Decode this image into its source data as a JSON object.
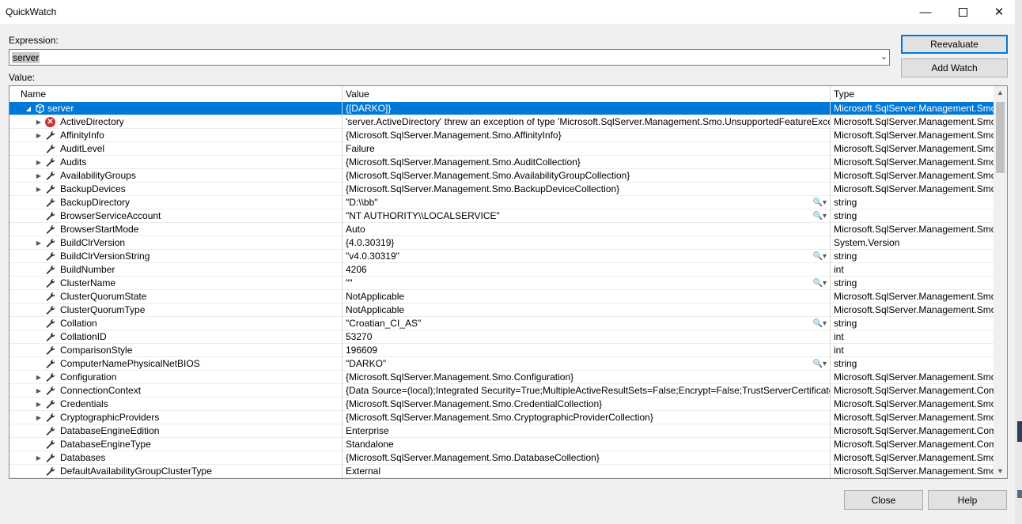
{
  "window": {
    "title": "QuickWatch"
  },
  "labels": {
    "expression": "Expression:",
    "value": "Value:"
  },
  "expression": {
    "value": "server"
  },
  "buttons": {
    "reevaluate": "Reevaluate",
    "add_watch": "Add Watch",
    "close": "Close",
    "help": "Help"
  },
  "columns": {
    "name": "Name",
    "value": "Value",
    "type": "Type"
  },
  "rows": [
    {
      "name": "server",
      "value": "{[DARKO]}",
      "type": "Microsoft.SqlServer.Management.Smo.Server",
      "expander": "collapse",
      "icon": "object-icon",
      "selected": true,
      "mag": false,
      "level": 0
    },
    {
      "name": "ActiveDirectory",
      "value": "'server.ActiveDirectory' threw an exception of type 'Microsoft.SqlServer.Management.Smo.UnsupportedFeatureException'",
      "type": "Microsoft.SqlServer.Management.Smo.ServerActiveDirectory",
      "expander": "expand",
      "icon": "error-icon",
      "mag": false,
      "level": 1
    },
    {
      "name": "AffinityInfo",
      "value": "{Microsoft.SqlServer.Management.Smo.AffinityInfo}",
      "type": "Microsoft.SqlServer.Management.Smo.AffinityInfo",
      "expander": "expand",
      "icon": "wrench-icon",
      "mag": false,
      "level": 1
    },
    {
      "name": "AuditLevel",
      "value": "Failure",
      "type": "Microsoft.SqlServer.Management.Smo.AuditLevel",
      "expander": "",
      "icon": "wrench-icon",
      "mag": false,
      "level": 1
    },
    {
      "name": "Audits",
      "value": "{Microsoft.SqlServer.Management.Smo.AuditCollection}",
      "type": "Microsoft.SqlServer.Management.Smo.AuditCollection",
      "expander": "expand",
      "icon": "wrench-icon",
      "mag": false,
      "level": 1
    },
    {
      "name": "AvailabilityGroups",
      "value": "{Microsoft.SqlServer.Management.Smo.AvailabilityGroupCollection}",
      "type": "Microsoft.SqlServer.Management.Smo.AvailabilityGroupCollection",
      "expander": "expand",
      "icon": "wrench-icon",
      "mag": false,
      "level": 1
    },
    {
      "name": "BackupDevices",
      "value": "{Microsoft.SqlServer.Management.Smo.BackupDeviceCollection}",
      "type": "Microsoft.SqlServer.Management.Smo.BackupDeviceCollection",
      "expander": "expand",
      "icon": "wrench-icon",
      "mag": false,
      "level": 1
    },
    {
      "name": "BackupDirectory",
      "value": "\"D:\\\\bb\"",
      "type": "string",
      "expander": "",
      "icon": "wrench-icon",
      "mag": true,
      "level": 1
    },
    {
      "name": "BrowserServiceAccount",
      "value": "\"NT AUTHORITY\\\\LOCALSERVICE\"",
      "type": "string",
      "expander": "",
      "icon": "wrench-icon",
      "mag": true,
      "level": 1
    },
    {
      "name": "BrowserStartMode",
      "value": "Auto",
      "type": "Microsoft.SqlServer.Management.Smo.ServiceStartMode",
      "expander": "",
      "icon": "wrench-icon",
      "mag": false,
      "level": 1
    },
    {
      "name": "BuildClrVersion",
      "value": "{4.0.30319}",
      "type": "System.Version",
      "expander": "expand",
      "icon": "wrench-icon",
      "mag": false,
      "level": 1
    },
    {
      "name": "BuildClrVersionString",
      "value": "\"v4.0.30319\"",
      "type": "string",
      "expander": "",
      "icon": "wrench-icon",
      "mag": true,
      "level": 1
    },
    {
      "name": "BuildNumber",
      "value": "4206",
      "type": "int",
      "expander": "",
      "icon": "wrench-icon",
      "mag": false,
      "level": 1
    },
    {
      "name": "ClusterName",
      "value": "\"\"",
      "type": "string",
      "expander": "",
      "icon": "wrench-icon",
      "mag": true,
      "level": 1
    },
    {
      "name": "ClusterQuorumState",
      "value": "NotApplicable",
      "type": "Microsoft.SqlServer.Management.Smo.ClusterQuorumState",
      "expander": "",
      "icon": "wrench-icon",
      "mag": false,
      "level": 1
    },
    {
      "name": "ClusterQuorumType",
      "value": "NotApplicable",
      "type": "Microsoft.SqlServer.Management.Smo.ClusterQuorumType",
      "expander": "",
      "icon": "wrench-icon",
      "mag": false,
      "level": 1
    },
    {
      "name": "Collation",
      "value": "\"Croatian_CI_AS\"",
      "type": "string",
      "expander": "",
      "icon": "wrench-icon",
      "mag": true,
      "level": 1
    },
    {
      "name": "CollationID",
      "value": "53270",
      "type": "int",
      "expander": "",
      "icon": "wrench-icon",
      "mag": false,
      "level": 1
    },
    {
      "name": "ComparisonStyle",
      "value": "196609",
      "type": "int",
      "expander": "",
      "icon": "wrench-icon",
      "mag": false,
      "level": 1
    },
    {
      "name": "ComputerNamePhysicalNetBIOS",
      "value": "\"DARKO\"",
      "type": "string",
      "expander": "",
      "icon": "wrench-icon",
      "mag": true,
      "level": 1
    },
    {
      "name": "Configuration",
      "value": "{Microsoft.SqlServer.Management.Smo.Configuration}",
      "type": "Microsoft.SqlServer.Management.Smo.Configuration",
      "expander": "expand",
      "icon": "wrench-icon",
      "mag": false,
      "level": 1
    },
    {
      "name": "ConnectionContext",
      "value": "{Data Source=(local);Integrated Security=True;MultipleActiveResultSets=False;Encrypt=False;TrustServerCertificate=False}",
      "type": "Microsoft.SqlServer.Management.Common.ServerConnection",
      "expander": "expand",
      "icon": "wrench-icon",
      "mag": false,
      "level": 1
    },
    {
      "name": "Credentials",
      "value": "{Microsoft.SqlServer.Management.Smo.CredentialCollection}",
      "type": "Microsoft.SqlServer.Management.Smo.CredentialCollection",
      "expander": "expand",
      "icon": "wrench-icon",
      "mag": false,
      "level": 1
    },
    {
      "name": "CryptographicProviders",
      "value": "{Microsoft.SqlServer.Management.Smo.CryptographicProviderCollection}",
      "type": "Microsoft.SqlServer.Management.Smo.CryptographicProviderCollection",
      "expander": "expand",
      "icon": "wrench-icon",
      "mag": false,
      "level": 1
    },
    {
      "name": "DatabaseEngineEdition",
      "value": "Enterprise",
      "type": "Microsoft.SqlServer.Management.Common.DatabaseEngineEdition",
      "expander": "",
      "icon": "wrench-icon",
      "mag": false,
      "level": 1
    },
    {
      "name": "DatabaseEngineType",
      "value": "Standalone",
      "type": "Microsoft.SqlServer.Management.Common.DatabaseEngineType",
      "expander": "",
      "icon": "wrench-icon",
      "mag": false,
      "level": 1
    },
    {
      "name": "Databases",
      "value": "{Microsoft.SqlServer.Management.Smo.DatabaseCollection}",
      "type": "Microsoft.SqlServer.Management.Smo.DatabaseCollection",
      "expander": "expand",
      "icon": "wrench-icon",
      "mag": false,
      "level": 1
    },
    {
      "name": "DefaultAvailabilityGroupClusterType",
      "value": "External",
      "type": "Microsoft.SqlServer.Management.Smo.AvailabilityGroupClusterType",
      "expander": "",
      "icon": "wrench-icon",
      "mag": false,
      "level": 1
    }
  ],
  "colors": {
    "selection": "#0078d7",
    "error": "#d32f2f"
  }
}
